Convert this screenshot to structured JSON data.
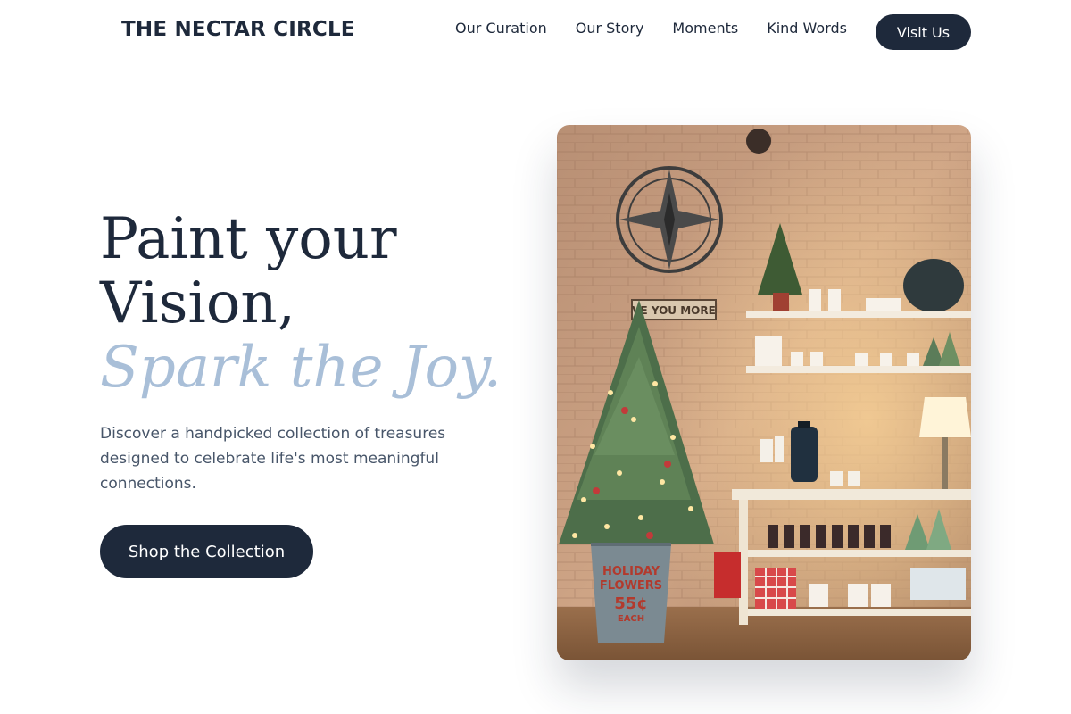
{
  "header": {
    "brand": "THE NECTAR CIRCLE",
    "nav": [
      "Our Curation",
      "Our Story",
      "Moments",
      "Kind Words"
    ],
    "cta": "Visit Us"
  },
  "hero": {
    "title_line1": "Paint your",
    "title_line2": "Vision,",
    "title_accent": "Spark the Joy.",
    "description": "Discover a handpicked collection of treasures designed to celebrate life's most meaningful connections.",
    "button": "Shop the Collection"
  },
  "photo": {
    "sign_text": "VE YOU MORE",
    "bucket_line1": "HOLIDAY",
    "bucket_line2": "FLOWERS",
    "bucket_price": "55¢",
    "bucket_each": "EACH"
  },
  "colors": {
    "primary": "#1e293b",
    "accent": "#a9bfd8",
    "body_text": "#475569"
  }
}
